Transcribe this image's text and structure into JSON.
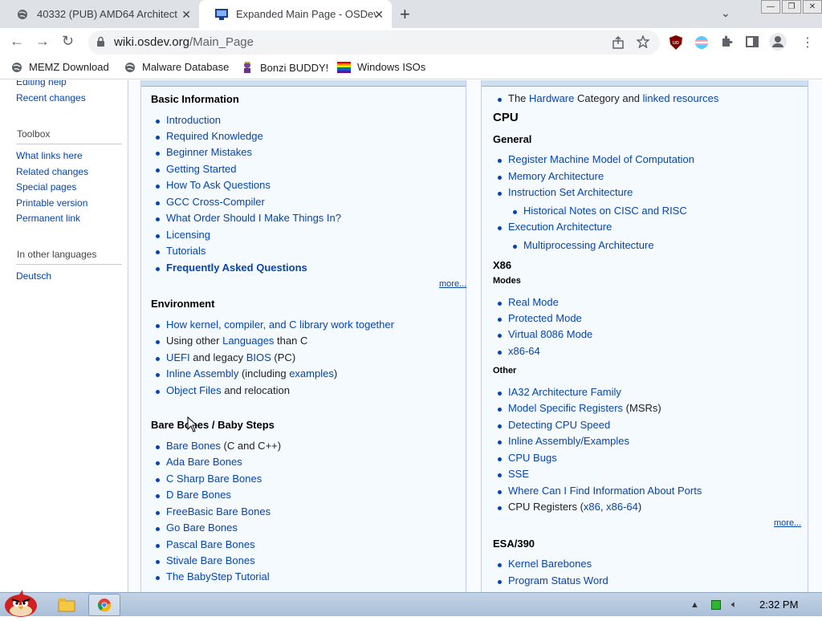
{
  "browser": {
    "tabs": [
      {
        "title": "40332 (PUB) AMD64 Architect",
        "active": false
      },
      {
        "title": "Expanded Main Page - OSDev",
        "active": true
      }
    ],
    "url_host": "wiki.osdev.org",
    "url_path": "/Main_Page",
    "bookmarks": [
      "MEMZ Download",
      "Malware Database",
      "Bonzi BUDDY!",
      "Windows ISOs"
    ]
  },
  "sidebar": {
    "top_links": [
      "Editing help",
      "Recent changes"
    ],
    "toolbox_title": "Toolbox",
    "toolbox_links": [
      "What links here",
      "Related changes",
      "Special pages",
      "Printable version",
      "Permanent link"
    ],
    "lang_title": "In other languages",
    "lang_links": [
      "Deutsch"
    ]
  },
  "left_panel": {
    "basic_title": "Basic Information",
    "basic_items": [
      "Introduction",
      "Required Knowledge",
      "Beginner Mistakes",
      "Getting Started",
      "How To Ask Questions",
      "GCC Cross-Compiler",
      "What Order Should I Make Things In?",
      "Licensing",
      "Tutorials",
      "Frequently Asked Questions"
    ],
    "more": "more...",
    "env_title": "Environment",
    "env_items": [
      {
        "link": "How kernel, compiler, and C library work together"
      },
      {
        "pre": "Using other ",
        "link": "Languages",
        "post": " than C"
      },
      {
        "link": "UEFI",
        "post": " and legacy ",
        "link2": "BIOS",
        "post2": " (PC)"
      },
      {
        "link": "Inline Assembly",
        "post": " (including ",
        "link2": "examples",
        "post2": ")"
      },
      {
        "link": "Object Files",
        "post": " and relocation"
      }
    ],
    "bare_title": "Bare Bones / Baby Steps",
    "bare_items": [
      {
        "link": "Bare Bones",
        "post": " (C and C++)"
      },
      {
        "link": "Ada Bare Bones"
      },
      {
        "link": "C Sharp Bare Bones"
      },
      {
        "link": "D Bare Bones"
      },
      {
        "link": "FreeBasic Bare Bones"
      },
      {
        "link": "Go Bare Bones"
      },
      {
        "link": "Pascal Bare Bones"
      },
      {
        "link": "Stivale Bare Bones"
      },
      {
        "link": "The BabyStep Tutorial"
      }
    ]
  },
  "right_panel": {
    "hw_line": {
      "pre": "The ",
      "link": "Hardware",
      "post": " Category and ",
      "link2": "linked resources"
    },
    "cpu_title": "CPU",
    "general_title": "General",
    "general_items": [
      {
        "text": "Register Machine Model of Computation",
        "sub": false
      },
      {
        "text": "Memory Architecture",
        "sub": false
      },
      {
        "text": "Instruction Set Architecture",
        "sub": false
      },
      {
        "text": "Historical Notes on CISC and RISC",
        "sub": true
      },
      {
        "text": "Execution Architecture",
        "sub": false
      },
      {
        "text": "Multiprocessing Architecture",
        "sub": true
      }
    ],
    "x86_title": "X86",
    "modes_title": "Modes",
    "modes_items": [
      "Real Mode",
      "Protected Mode",
      "Virtual 8086 Mode",
      "x86-64"
    ],
    "other_title": "Other",
    "other_items": [
      {
        "link": "IA32 Architecture Family"
      },
      {
        "link": "Model Specific Registers",
        "post": " (MSRs)"
      },
      {
        "link": "Detecting CPU Speed"
      },
      {
        "link": "Inline Assembly/Examples"
      },
      {
        "link": "CPU Bugs"
      },
      {
        "link": "SSE"
      },
      {
        "link": "Where Can I Find Information About Ports"
      },
      {
        "pre": "CPU Registers (",
        "link": "x86",
        "post": ", ",
        "link2": "x86-64",
        "post2": ")"
      }
    ],
    "more": "more...",
    "esa_title": "ESA/390",
    "esa_items": [
      "Kernel Barebones",
      "Program Status Word"
    ]
  },
  "taskbar": {
    "clock": "2:32 PM"
  },
  "icons": [
    "globe-icon",
    "osdev-favicon",
    "close-icon",
    "plus-icon",
    "back-icon",
    "forward-icon",
    "reload-icon",
    "lock-icon",
    "share-icon",
    "star-icon",
    "ublock-icon",
    "extension-icon",
    "puzzle-icon",
    "sidepanel-icon",
    "profile-icon",
    "menu-icon"
  ],
  "colors": {
    "link": "#0645ad",
    "panel_bg": "#f5faff",
    "taskbar": "#b8cbe1"
  }
}
